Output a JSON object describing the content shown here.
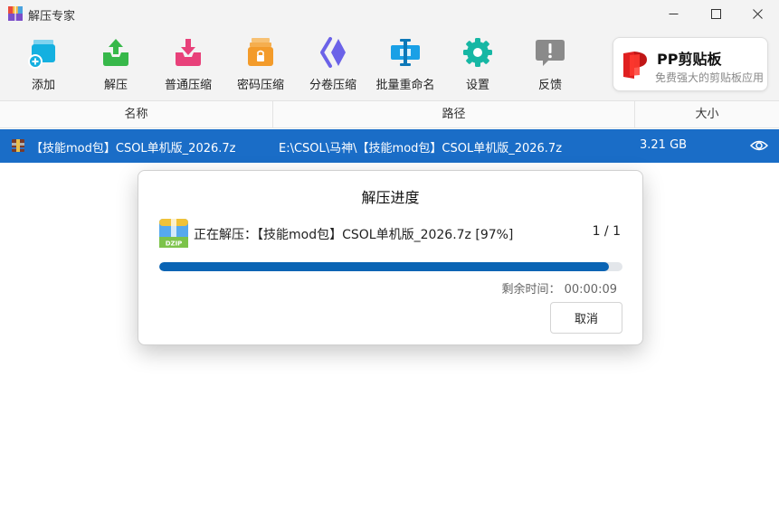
{
  "window": {
    "title": "解压专家"
  },
  "toolbar": {
    "items": [
      {
        "label": "添加",
        "icon": "add-folder-icon",
        "color": "#14b0e0"
      },
      {
        "label": "解压",
        "icon": "extract-icon",
        "color": "#37b84a"
      },
      {
        "label": "普通压缩",
        "icon": "compress-icon",
        "color": "#e8417a"
      },
      {
        "label": "密码压缩",
        "icon": "lock-icon",
        "color": "#f39b2a"
      },
      {
        "label": "分卷压缩",
        "icon": "split-volume-icon",
        "color": "#6b62e8"
      },
      {
        "label": "批量重命名",
        "icon": "batch-rename-icon",
        "color": "#1aa0e6"
      },
      {
        "label": "设置",
        "icon": "gear-icon",
        "color": "#16b7a4"
      },
      {
        "label": "反馈",
        "icon": "feedback-icon",
        "color": "#8a8a8a"
      }
    ]
  },
  "promo": {
    "name": "PP剪贴板",
    "subtitle": "免费强大的剪贴板应用"
  },
  "columns": {
    "name": "名称",
    "path": "路径",
    "size": "大小"
  },
  "files": [
    {
      "name": "【技能mod包】CSOL单机版_2026.7z",
      "path": "E:\\CSOL\\马神\\【技能mod包】CSOL单机版_2026.7z",
      "size": "3.21 GB"
    }
  ],
  "dialog": {
    "title": "解压进度",
    "status": "正在解压：【技能mod包】CSOL单机版_2026.7z   [97%]",
    "count": "1 / 1",
    "progress": 0.97,
    "remaining": "剩余时间：   00:00:09",
    "cancel_label": "取消"
  }
}
